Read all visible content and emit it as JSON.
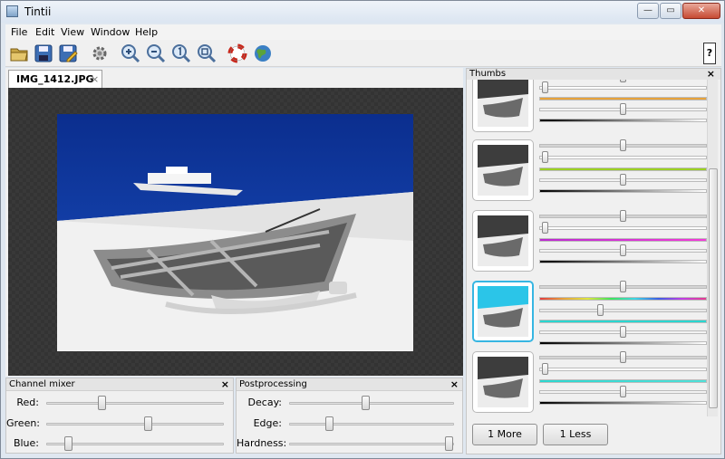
{
  "window": {
    "title": "Tintii"
  },
  "menu": [
    "File",
    "Edit",
    "View",
    "Window",
    "Help"
  ],
  "toolbar": {
    "help_label": "?"
  },
  "document": {
    "tab_label": "IMG_1412.JPG",
    "tab_close": "×"
  },
  "channel_mixer": {
    "title": "Channel mixer",
    "close": "×",
    "sliders": [
      {
        "label": "Red:",
        "value": 0.3
      },
      {
        "label": "Green:",
        "value": 0.58
      },
      {
        "label": "Blue:",
        "value": 0.1
      }
    ]
  },
  "postprocessing": {
    "title": "Postprocessing",
    "close": "×",
    "sliders": [
      {
        "label": "Decay:",
        "value": 0.46
      },
      {
        "label": "Edge:",
        "value": 0.23
      },
      {
        "label": "Hardness:",
        "value": 1.0
      }
    ]
  },
  "thumbs": {
    "title": "Thumbs",
    "close": "×",
    "more_label": "1 More",
    "less_label": "1 Less",
    "colors": {
      "selected_border": "#37b6e2",
      "orange": "#e7a33b",
      "green": "#9bd021",
      "magenta": "#d23ad0",
      "cyan": "#2ad7d0"
    }
  }
}
